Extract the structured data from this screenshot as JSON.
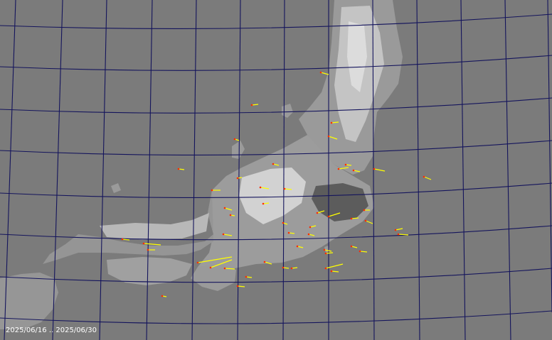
{
  "map": {
    "colors": {
      "sea": "#7b7b7b",
      "land_low": "#8e8e8e",
      "land_mid": "#a6a6a6",
      "land_high": "#cfcfcf",
      "plain": "#5e5e5e",
      "grid": "#14145c",
      "vector": "#ffff00",
      "vector_origin": "#ff2a00"
    },
    "date_range": {
      "start": "2025/06/16",
      "separator": "..",
      "end": "2025/06/30"
    }
  }
}
